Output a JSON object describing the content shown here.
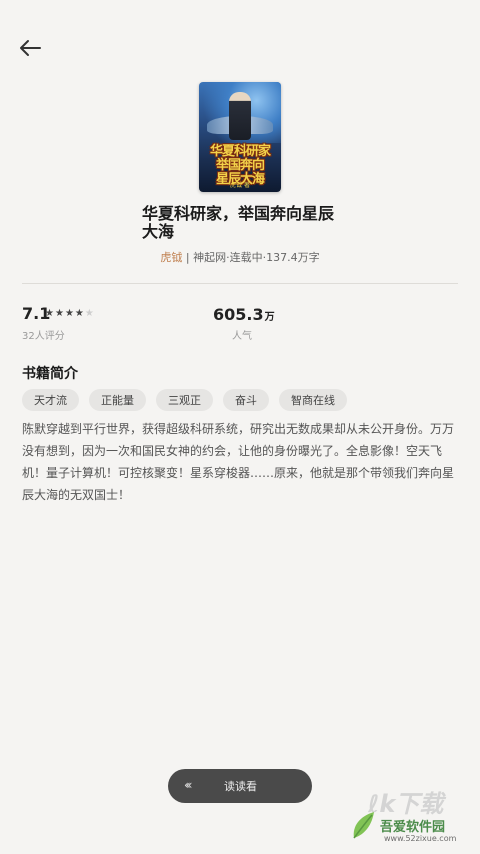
{
  "nav": {
    "back_icon": "arrow-left-icon"
  },
  "book": {
    "cover_line1": "华夏科研家",
    "cover_line2": "举国奔向",
    "cover_line3": "星辰大海",
    "cover_author": "虎钺 著",
    "title": "华夏科研家，举国奔向星辰大海",
    "author": "虎钺",
    "meta_rest": " | 神起网·连载中·137.4万字"
  },
  "stats": {
    "rating": "7.1",
    "stars_filled": 3.5,
    "stars_total": 5,
    "rating_count": "32人评分",
    "popularity": "605.3",
    "popularity_unit": "万",
    "popularity_label": "人气"
  },
  "intro": {
    "section_title": "书籍简介",
    "tags": [
      "天才流",
      "正能量",
      "三观正",
      "奋斗",
      "智商在线"
    ],
    "description": "陈默穿越到平行世界，获得超级科研系统，研究出无数成果却从未公开身份。万万没有想到，因为一次和国民女神的约会，让他的身份曝光了。全息影像！空天飞机！量子计算机！可控核聚变！星系穿梭器……原来，他就是那个带领我们奔向星辰大海的无双国士！"
  },
  "actions": {
    "read_label": "读读看",
    "read_icon": "chevron-left-triple-icon"
  },
  "watermark": {
    "big": "吾爱下载",
    "name": "吾爱软件园",
    "url": "www.52zixue.com"
  },
  "colors": {
    "background": "#f5f4f2",
    "author": "#c08050",
    "button": "#4a4a4a"
  }
}
